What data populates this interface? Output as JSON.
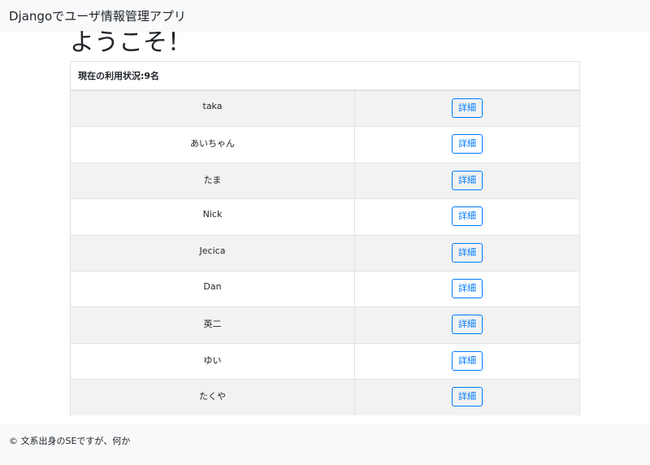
{
  "navbar": {
    "brand": "Djangoでユーザ情報管理アプリ"
  },
  "main": {
    "heading": "ようこそ！",
    "panel_header": "現在の利用状況:9名",
    "users": [
      {
        "name": "taka",
        "detail_label": "詳細"
      },
      {
        "name": "あいちゃん",
        "detail_label": "詳細"
      },
      {
        "name": "たま",
        "detail_label": "詳細"
      },
      {
        "name": "Nick",
        "detail_label": "詳細"
      },
      {
        "name": "Jecica",
        "detail_label": "詳細"
      },
      {
        "name": "Dan",
        "detail_label": "詳細"
      },
      {
        "name": "英二",
        "detail_label": "詳細"
      },
      {
        "name": "ゆい",
        "detail_label": "詳細"
      },
      {
        "name": "たくや",
        "detail_label": "詳細"
      }
    ]
  },
  "footer": {
    "text": "© 文系出身のSEですが、何か"
  },
  "colors": {
    "primary": "#007bff",
    "bar_background": "#f8f9fa",
    "stripe": "#f2f2f2",
    "border": "#dee2e6"
  }
}
